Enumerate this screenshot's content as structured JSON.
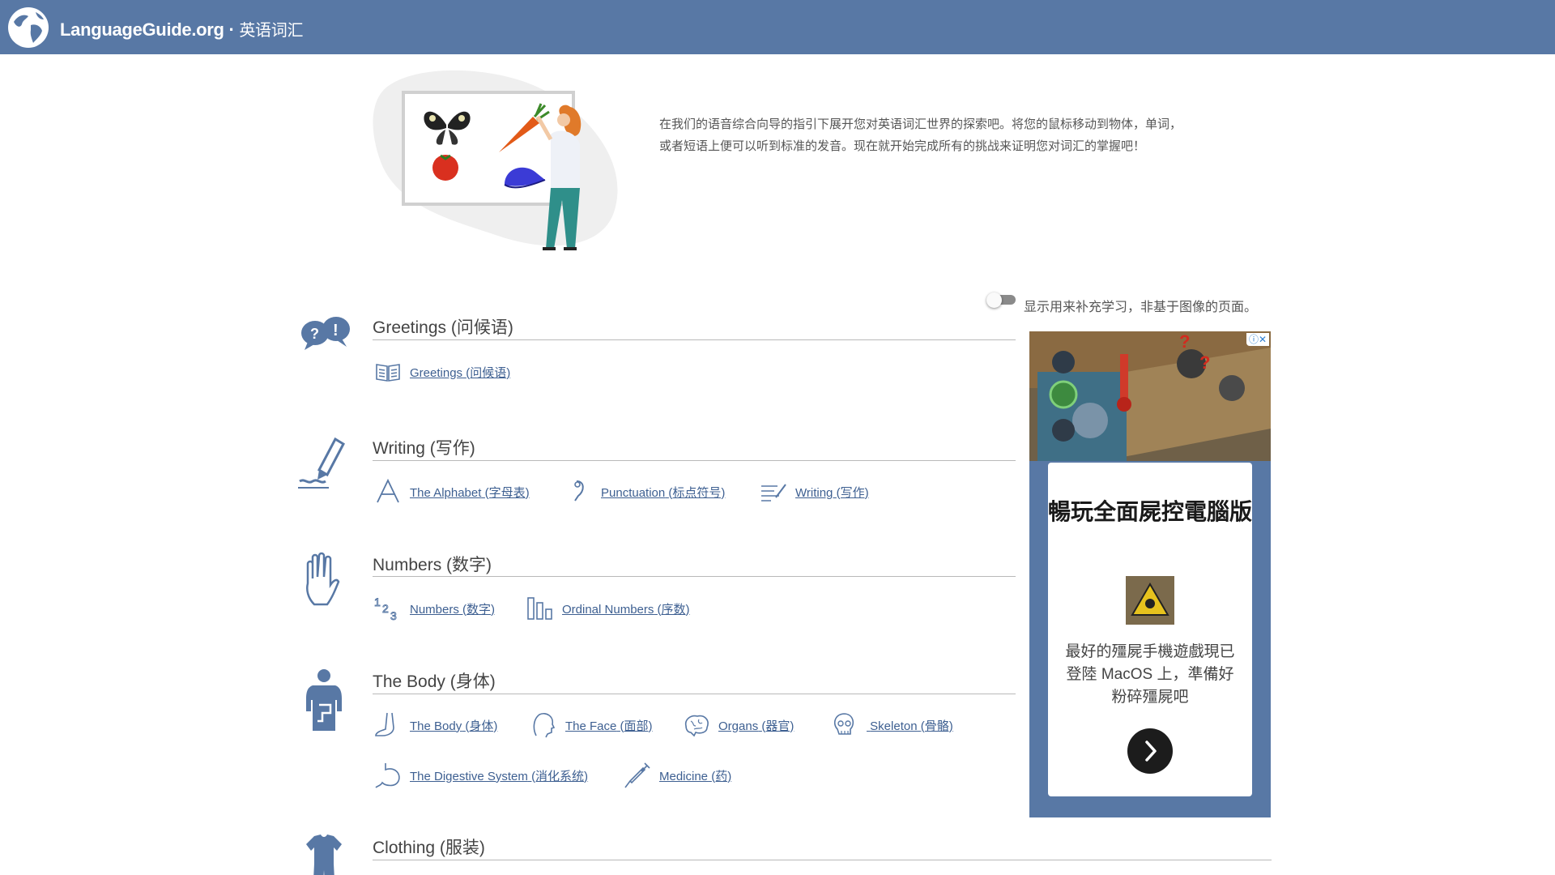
{
  "header": {
    "brand": "LanguageGuide.org",
    "separator": " · ",
    "subtitle": "英语词汇"
  },
  "intro": {
    "text": "在我们的语音综合向导的指引下展开您对英语词汇世界的探索吧。将您的鼠标移动到物体，单词，或者短语上便可以听到标准的发音。现在就开始完成所有的挑战来证明您对词汇的掌握吧！"
  },
  "toggle": {
    "label": "显示用来补充学习，非基于图像的页面。",
    "on": false
  },
  "sections": {
    "greetings": {
      "title": "Greetings (问候语)",
      "items": [
        {
          "label_en": "Greetings",
          "label_zh": "(问候语)",
          "icon": "book-icon"
        }
      ]
    },
    "writing": {
      "title": "Writing (写作)",
      "items": [
        {
          "label_en": "The Alphabet",
          "label_zh": "(字母表)",
          "icon": "letter-a-icon"
        },
        {
          "label_en": "Punctuation",
          "label_zh": "(标点符号)",
          "icon": "punctuation-icon"
        },
        {
          "label_en": "Writing",
          "label_zh": "(写作)",
          "icon": "lines-icon"
        }
      ]
    },
    "numbers": {
      "title": "Numbers (数字)",
      "items": [
        {
          "label_en": "Numbers",
          "label_zh": "(数字)",
          "icon": "numbers-icon"
        },
        {
          "label_en": "Ordinal Numbers",
          "label_zh": "(序数)",
          "icon": "bars-icon"
        }
      ]
    },
    "body": {
      "title": "The Body (身体)",
      "items": [
        {
          "label_en": "The Body",
          "label_zh": "(身体)",
          "icon": "foot-icon"
        },
        {
          "label_en": "The Face",
          "label_zh": "(面部)",
          "icon": "face-icon"
        },
        {
          "label_en": "Organs",
          "label_zh": "(器官)",
          "icon": "brain-icon"
        },
        {
          "label_en": "Skeleton",
          "label_zh": "(骨骼)",
          "icon": "skull-icon"
        },
        {
          "label_en": "The Digestive System",
          "label_zh": "(消化系统)",
          "icon": "stomach-icon"
        },
        {
          "label_en": "Medicine",
          "label_zh": "(药)",
          "icon": "syringe-icon"
        }
      ]
    },
    "clothing": {
      "title": "Clothing (服装)"
    }
  },
  "ad": {
    "choice": "ⓘ✕",
    "headline": "暢玩全面屍控電腦版",
    "body": "最好的殭屍手機遊戲現已登陸 MacOS 上，準備好粉碎殭屍吧",
    "cta_icon": "chevron-right-icon"
  },
  "colors": {
    "header_bg": "#5878a5",
    "link": "#3d5f91",
    "ad_bg": "#5878a5"
  }
}
